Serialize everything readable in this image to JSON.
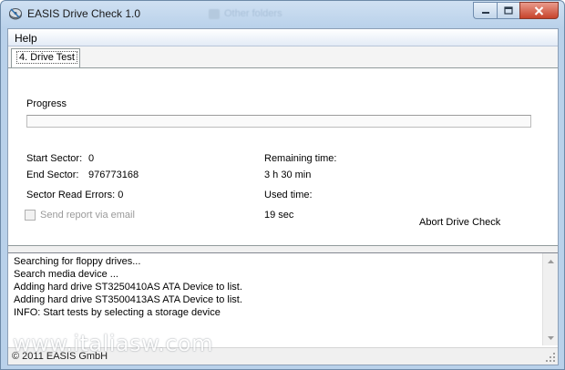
{
  "window": {
    "title": "EASIS Drive Check 1.0",
    "background_title": "Other folders",
    "minimize_icon": "minimize-icon",
    "maximize_icon": "maximize-icon",
    "close_icon": "close-icon"
  },
  "menu": {
    "help": "Help"
  },
  "tabs": [
    {
      "label": "4. Drive Test"
    }
  ],
  "drive_test": {
    "progress_label": "Progress",
    "progress_value": 0,
    "start_sector_label": "Start Sector:",
    "start_sector_value": "0",
    "end_sector_label": "End Sector:",
    "end_sector_value": "976773168",
    "sector_errors_label": "Sector Read Errors: 0",
    "send_report_label": "Send report via email",
    "send_report_checked": false,
    "remaining_label": "Remaining time:",
    "remaining_value": "3 h 30 min",
    "used_label": "Used time:",
    "used_value": "19 sec",
    "abort_label": "Abort Drive Check"
  },
  "log": {
    "lines": [
      "Searching for floppy drives...",
      "Search media device ...",
      "Adding hard drive ST3250410AS ATA Device to list.",
      "Adding hard drive ST3500413AS ATA Device to list.",
      "INFO: Start tests by selecting a storage device"
    ]
  },
  "status": {
    "copyright": "© 2011 EASIS GmbH"
  },
  "watermark": "www.italiasw.com",
  "colors": {
    "accent": "#b9d1ea",
    "close_red": "#c7432b"
  }
}
